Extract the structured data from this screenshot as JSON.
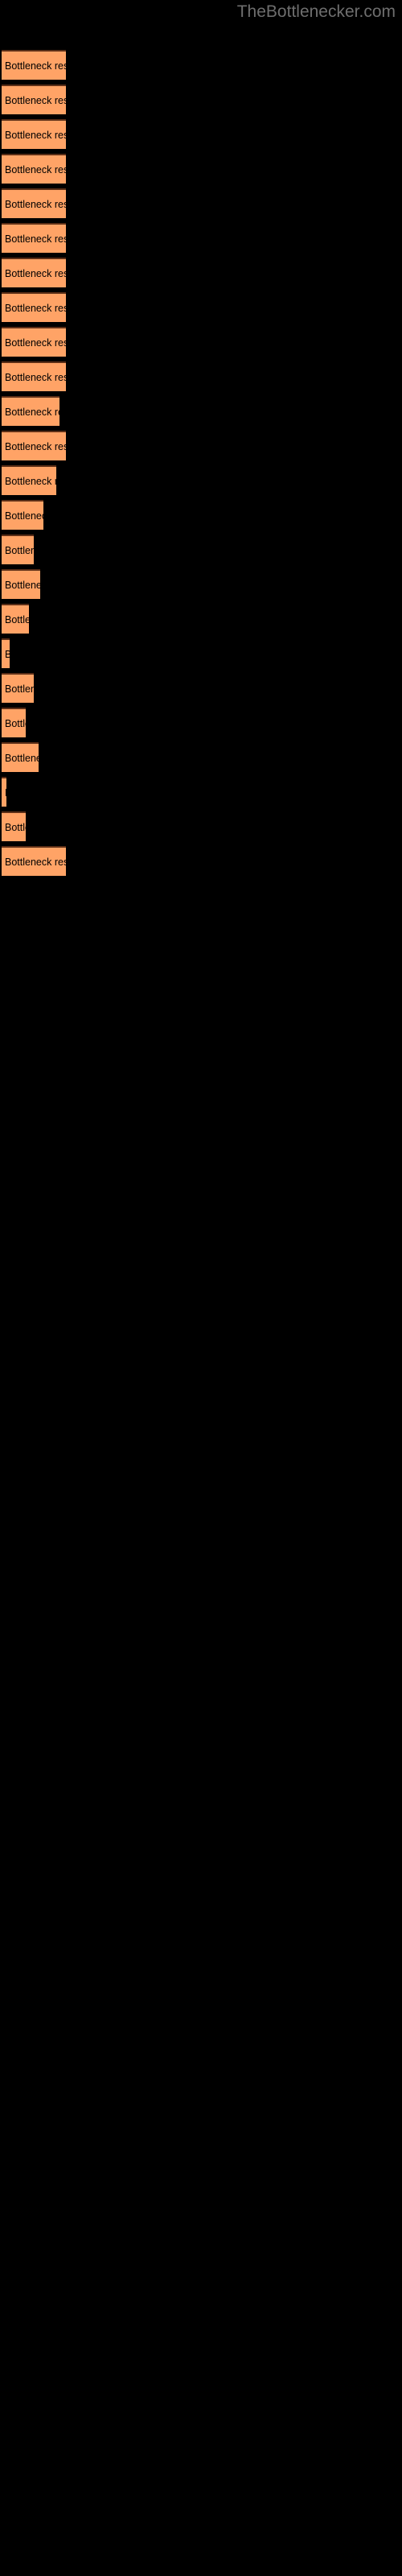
{
  "site": {
    "watermark": "TheBottlenecker.com"
  },
  "colors": {
    "background": "#000000",
    "bar_fill": "#ffa366",
    "bar_border_top": "#5c2f17",
    "bar_label_text": "#000000",
    "watermark_text": "#6e6e6e"
  },
  "chart_data": {
    "type": "bar",
    "orientation": "horizontal",
    "title": "",
    "subtitle": "",
    "xlabel": "",
    "ylabel": "",
    "grid": false,
    "legend": null,
    "axis_labels_visible": false,
    "tick_labels": [],
    "xlim": [
      0,
      100
    ],
    "bar_label_text": "Bottleneck result",
    "categories": [
      "Bottleneck result",
      "Bottleneck result",
      "Bottleneck result",
      "Bottleneck result",
      "Bottleneck result",
      "Bottleneck result",
      "Bottleneck result",
      "Bottleneck result",
      "Bottleneck result",
      "Bottleneck result",
      "Bottleneck result",
      "Bottleneck result",
      "Bottleneck result",
      "Bottleneck result",
      "Bottleneck result",
      "Bottleneck result",
      "Bottleneck result",
      "Bottleneck result",
      "Bottleneck result",
      "Bottleneck result",
      "Bottleneck result",
      "Bottleneck result",
      "Bottleneck result",
      "Bottleneck result"
    ],
    "values": [
      80,
      80,
      80,
      80,
      80,
      80,
      80,
      80,
      80,
      80,
      72,
      80,
      68,
      52,
      40,
      48,
      34,
      10,
      40,
      30,
      46,
      6,
      30,
      80
    ],
    "bars": [
      {
        "index": 1,
        "label": "Bottleneck result",
        "visible_label": "Bottleneck result",
        "y": 62,
        "width": 80
      },
      {
        "index": 2,
        "label": "Bottleneck result",
        "visible_label": "Bottleneck result",
        "y": 105,
        "width": 80
      },
      {
        "index": 3,
        "label": "Bottleneck result",
        "visible_label": "Bottleneck result",
        "y": 148,
        "width": 80
      },
      {
        "index": 4,
        "label": "Bottleneck result",
        "visible_label": "Bottleneck result",
        "y": 191,
        "width": 80
      },
      {
        "index": 5,
        "label": "Bottleneck result",
        "visible_label": "Bottleneck result",
        "y": 234,
        "width": 80
      },
      {
        "index": 6,
        "label": "Bottleneck result",
        "visible_label": "Bottleneck result",
        "y": 277,
        "width": 80
      },
      {
        "index": 7,
        "label": "Bottleneck result",
        "visible_label": "Bottleneck result",
        "y": 320,
        "width": 80
      },
      {
        "index": 8,
        "label": "Bottleneck result",
        "visible_label": "Bottleneck result",
        "y": 363,
        "width": 80
      },
      {
        "index": 9,
        "label": "Bottleneck result",
        "visible_label": "Bottleneck result",
        "y": 406,
        "width": 80
      },
      {
        "index": 10,
        "label": "Bottleneck result",
        "visible_label": "Bottleneck result",
        "y": 449,
        "width": 80
      },
      {
        "index": 11,
        "label": "Bottleneck result",
        "visible_label": "Bottleneck resu",
        "y": 492,
        "width": 72
      },
      {
        "index": 12,
        "label": "Bottleneck result",
        "visible_label": "Bottleneck result",
        "y": 535,
        "width": 80
      },
      {
        "index": 13,
        "label": "Bottleneck result",
        "visible_label": "Bottleneck resu",
        "y": 578,
        "width": 68
      },
      {
        "index": 14,
        "label": "Bottleneck result",
        "visible_label": "Bottleneck r",
        "y": 621,
        "width": 52
      },
      {
        "index": 15,
        "label": "Bottleneck result",
        "visible_label": "Bottlen",
        "y": 664,
        "width": 40
      },
      {
        "index": 16,
        "label": "Bottleneck result",
        "visible_label": "Bottleneck",
        "y": 707,
        "width": 48
      },
      {
        "index": 17,
        "label": "Bottleneck result",
        "visible_label": "Bottle",
        "y": 750,
        "width": 34
      },
      {
        "index": 18,
        "label": "Bottleneck result",
        "visible_label": "B",
        "y": 793,
        "width": 10
      },
      {
        "index": 19,
        "label": "Bottleneck result",
        "visible_label": "Bottle",
        "y": 836,
        "width": 40
      },
      {
        "index": 20,
        "label": "Bottleneck result",
        "visible_label": "Bott",
        "y": 879,
        "width": 30
      },
      {
        "index": 21,
        "label": "Bottleneck result",
        "visible_label": "Bottlene",
        "y": 922,
        "width": 46
      },
      {
        "index": 22,
        "label": "Bottleneck result",
        "visible_label": "",
        "y": 965,
        "width": 6
      },
      {
        "index": 23,
        "label": "Bottleneck result",
        "visible_label": "Bottl",
        "y": 1008,
        "width": 30
      },
      {
        "index": 24,
        "label": "Bottleneck result",
        "visible_label": "Bottleneck result",
        "y": 1051,
        "width": 80
      }
    ]
  }
}
